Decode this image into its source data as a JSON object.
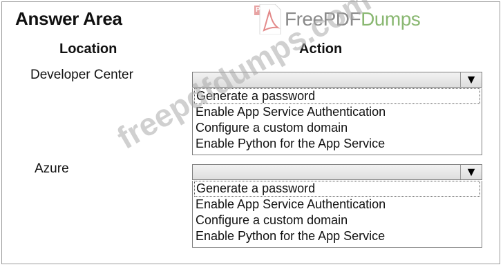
{
  "title": "Answer Area",
  "brand": {
    "free": "Free",
    "pdf": "PDF",
    "dumps": "Dumps",
    "logo_text": "PDF"
  },
  "columns": {
    "location": "Location",
    "action": "Action"
  },
  "rows": [
    {
      "location": "Developer Center",
      "selected_value": "",
      "options": [
        "Generate a password",
        "Enable App Service Authentication",
        "Configure a custom domain",
        "Enable Python for the App Service"
      ]
    },
    {
      "location": "Azure",
      "selected_value": "",
      "options": [
        "Generate a password",
        "Enable App Service Authentication",
        "Configure a custom domain",
        "Enable Python for the App Service"
      ]
    }
  ],
  "watermark": "freepdfdumps.com",
  "icons": {
    "dropdown": "chevron-down-icon",
    "logo": "pdf-file-icon"
  }
}
